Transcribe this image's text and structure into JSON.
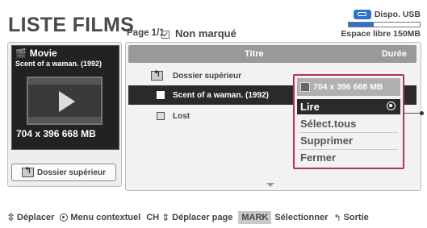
{
  "header": {
    "title": "LISTE FILMS",
    "page_info": "Page 1/1",
    "filter_label": "Non marqué"
  },
  "usb": {
    "label": "Dispo. USB",
    "free_space": "Espace libre 150MB",
    "usage_fraction": 0.35,
    "accent": "#2f72c9"
  },
  "preview": {
    "type_label": "Movie",
    "file_name": "Scent of a waman. (1992)",
    "resolution": "704 x 396  668 MB",
    "parent_folder_label": "Dossier supérieur"
  },
  "table": {
    "headers": {
      "title": "Titre",
      "duration": "Durée"
    },
    "rows": [
      {
        "icon": "folder-up-icon",
        "label": "Dossier supérieur",
        "duration": ""
      },
      {
        "icon": "file-icon",
        "label": "Scent of a waman. (1992)",
        "duration": "",
        "selected": true
      },
      {
        "icon": "file-icon",
        "label": "Lost",
        "duration": ""
      }
    ]
  },
  "context_menu": {
    "info": "704 x 396  668 MB",
    "items": [
      {
        "label": "Lire",
        "selected": true
      },
      {
        "label": "Sélect.tous"
      },
      {
        "label": "Supprimer"
      },
      {
        "label": "Fermer"
      }
    ],
    "border_color": "#b5315d"
  },
  "footer": {
    "move": "Déplacer",
    "context_menu": "Menu contextuel",
    "ch": "CH",
    "move_page": "Déplacer page",
    "mark_key": "MARK",
    "select": "Sélectionner",
    "exit": "Sortie"
  }
}
